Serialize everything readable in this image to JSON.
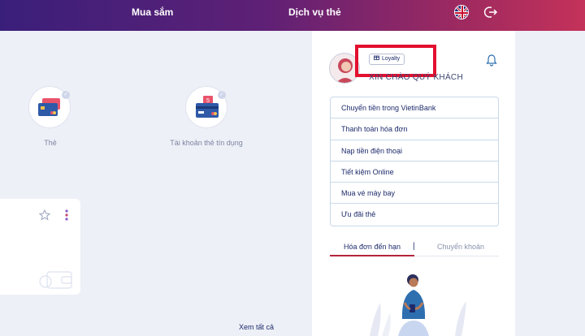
{
  "nav": {
    "shopping": "Mua sắm",
    "services": "Dịch vụ thẻ"
  },
  "icons": {
    "flag": "uk-flag-icon",
    "logout": "logout-icon",
    "bell": "bell-icon"
  },
  "services": [
    {
      "label": "Thẻ"
    },
    {
      "label": "Tài khoản thẻ tín dụng",
      "badge": "5"
    }
  ],
  "see_all": "Xem tất cả",
  "sidebar": {
    "loyalty": "Loyalty",
    "greeting": "XIN CHÀO QUÝ KHÁCH",
    "menu": [
      "Chuyển tiền trong VietinBank",
      "Thanh toán hóa đơn",
      "Nạp tiền điện thoại",
      "Tiết kiệm Online",
      "Mua vé máy bay",
      "Ưu đãi thẻ"
    ],
    "tabs": {
      "due_bills": "Hóa đơn đến hạn",
      "separator": "|",
      "transfer": "Chuyển khoản"
    }
  },
  "colors": {
    "highlight": "#e3102f",
    "brand_dark": "#1d2b6b",
    "tab_active": "#b3263b"
  }
}
